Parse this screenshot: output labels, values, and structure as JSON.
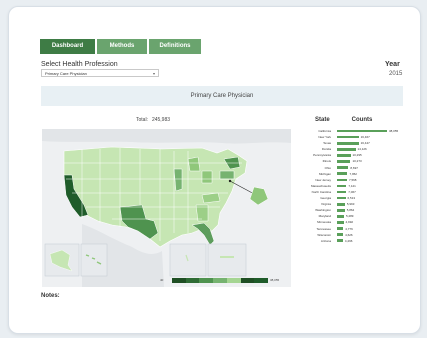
{
  "tabs": [
    {
      "label": "Dashboard"
    },
    {
      "label": "Methods"
    },
    {
      "label": "Definitions"
    }
  ],
  "select": {
    "label": "Select Health Profession",
    "value": "Primary Care Physician"
  },
  "year": {
    "label": "Year",
    "value": "2015"
  },
  "banner": {
    "title": "Primary Care Physician"
  },
  "total": {
    "label": "Total:",
    "value": "245,983"
  },
  "legend": {
    "min": "40",
    "max": "38,055"
  },
  "table": {
    "state_header": "State",
    "counts_header": "Counts",
    "rows": [
      {
        "state": "California",
        "count": "38,055",
        "value": 38055
      },
      {
        "state": "New York",
        "count": "16,467",
        "value": 16467
      },
      {
        "state": "Texas",
        "count": "16,447",
        "value": 16447
      },
      {
        "state": "Florida",
        "count": "14,126",
        "value": 14126
      },
      {
        "state": "Pennsylvania",
        "count": "10,295",
        "value": 10295
      },
      {
        "state": "Illinois",
        "count": "10,273",
        "value": 10273
      },
      {
        "state": "Ohio",
        "count": "8,697",
        "value": 8697
      },
      {
        "state": "Michigan",
        "count": "7,952",
        "value": 7952
      },
      {
        "state": "New Jersey",
        "count": "7,568",
        "value": 7568
      },
      {
        "state": "Massachusetts",
        "count": "7,121",
        "value": 7121
      },
      {
        "state": "North Carolina",
        "count": "7,067",
        "value": 7067
      },
      {
        "state": "Georgia",
        "count": "6,513",
        "value": 6513
      },
      {
        "state": "Virginia",
        "count": "5,993",
        "value": 5993
      },
      {
        "state": "Washington",
        "count": "5,864",
        "value": 5864
      },
      {
        "state": "Maryland",
        "count": "5,289",
        "value": 5289
      },
      {
        "state": "Minnesota",
        "count": "4,992",
        "value": 4992
      },
      {
        "state": "Tennessee",
        "count": "4,776",
        "value": 4776
      },
      {
        "state": "Wisconsin",
        "count": "4,626",
        "value": 4626
      },
      {
        "state": "Arizona",
        "count": "4,496",
        "value": 4496
      }
    ]
  },
  "notes": {
    "label": "Notes:"
  },
  "colors": {
    "tab_active": "#3e7c45",
    "tab_inactive": "#6aa46e",
    "bar": "#5aa05a",
    "banner_bg": "#e8f0f4",
    "map_light": "#c6e6b3",
    "map_mid": "#8fc77a",
    "map_dark": "#1f5c2a"
  }
}
